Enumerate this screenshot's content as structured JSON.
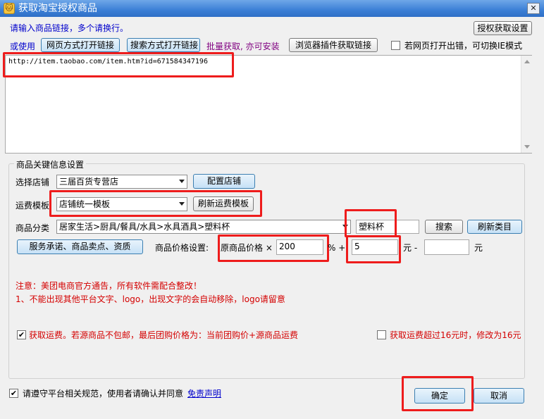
{
  "window": {
    "title": "获取淘宝授权商品",
    "close_glyph": "✕",
    "app_icon_glyph": "🐱"
  },
  "header": {
    "instruction": "请输入商品链接，多个请换行。",
    "auth_button": "授权获取设置",
    "or_use": "或使用",
    "web_open_button": "网页方式打开链接",
    "search_open_button": "搜索方式打开链接",
    "batch_hint": "批量获取, 亦可安装",
    "plugin_button": "浏览器插件获取链接",
    "ie_mode_label": "若网页打开出错，可切换IE模式"
  },
  "links_input": {
    "value": "http://item.taobao.com/item.htm?id=671584347196"
  },
  "settings": {
    "group_title": "商品关键信息设置",
    "store_label": "选择店铺",
    "store_value": "三届百货专营店",
    "config_store_button": "配置店铺",
    "shipping_label": "运费模板",
    "shipping_value": "店铺统一模板",
    "refresh_shipping_button": "刷新运费模板",
    "category_label": "商品分类",
    "category_value": "居家生活>厨具/餐具/水具>水具酒具>塑料杯",
    "category_search_value": "塑料杯",
    "search_button": "搜索",
    "refresh_category_button": "刷新类目",
    "service_button": "服务承诺、商品卖点、资质",
    "price_label": "商品价格设置:",
    "price_prefix": "原商品价格 ×",
    "price_multiplier": "200",
    "price_percent_plus": "% +",
    "price_add": "5",
    "price_yuan_minus": "元 -",
    "price_sub": "",
    "price_yuan": "元",
    "notice_title": "注意：美团电商官方通告，所有软件需配合整改！",
    "notice_line1": "1、不能出现其他平台文字、logo，出现文字的会自动移除，logo请留意",
    "shipping_fetch_label": "获取运费。若源商品不包邮，最后团购价格为：当前团购价+源商品运费",
    "shipping_limit_label": "获取运费超过16元时，修改为16元"
  },
  "footer": {
    "agree_label": "请遵守平台相关规范，使用者请确认并同意",
    "disclaimer_link": "免责声明",
    "ok_button": "确定",
    "cancel_button": "取消"
  },
  "checkboxes": {
    "ie_mode": false,
    "fetch_shipping": true,
    "shipping_limit": false,
    "agree": true
  },
  "check_glyph": "✔",
  "colors": {
    "highlight": "#ee1c1c",
    "title_bar": "#3b7fd6",
    "link_blue": "#0000cc",
    "accent_purple": "#800080",
    "warning_red": "#d40000"
  }
}
